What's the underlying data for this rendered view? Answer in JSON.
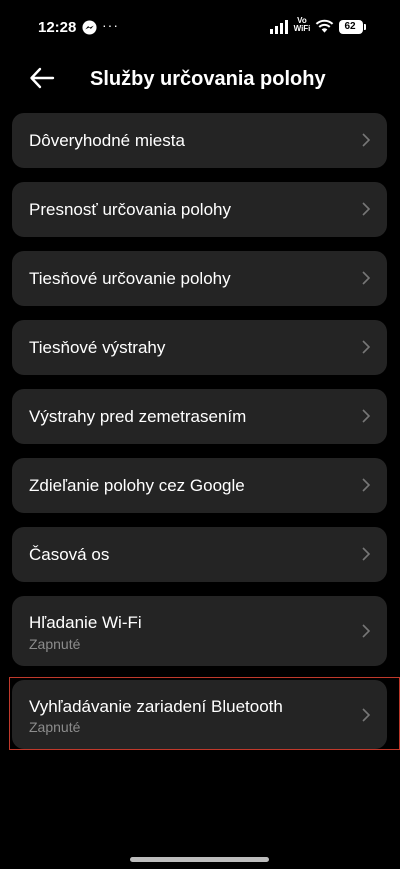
{
  "status_bar": {
    "time": "12:28",
    "more_indicator": "···",
    "network_label": "Vo\nWiFi",
    "battery_level": "62"
  },
  "header": {
    "title": "Služby určovania polohy"
  },
  "items": [
    {
      "label": "Dôveryhodné miesta"
    },
    {
      "label": "Presnosť určovania polohy"
    },
    {
      "label": "Tiesňové určovanie polohy"
    },
    {
      "label": "Tiesňové výstrahy"
    },
    {
      "label": "Výstrahy pred zemetrasením"
    },
    {
      "label": "Zdieľanie polohy cez Google"
    },
    {
      "label": "Časová os"
    },
    {
      "label": "Hľadanie Wi-Fi",
      "subtitle": "Zapnuté"
    },
    {
      "label": "Vyhľadávanie zariadení Bluetooth",
      "subtitle": "Zapnuté"
    }
  ],
  "colors": {
    "background": "#000000",
    "card": "#242424",
    "subtitle": "#8c8c8c",
    "highlight": "#c0392b"
  }
}
